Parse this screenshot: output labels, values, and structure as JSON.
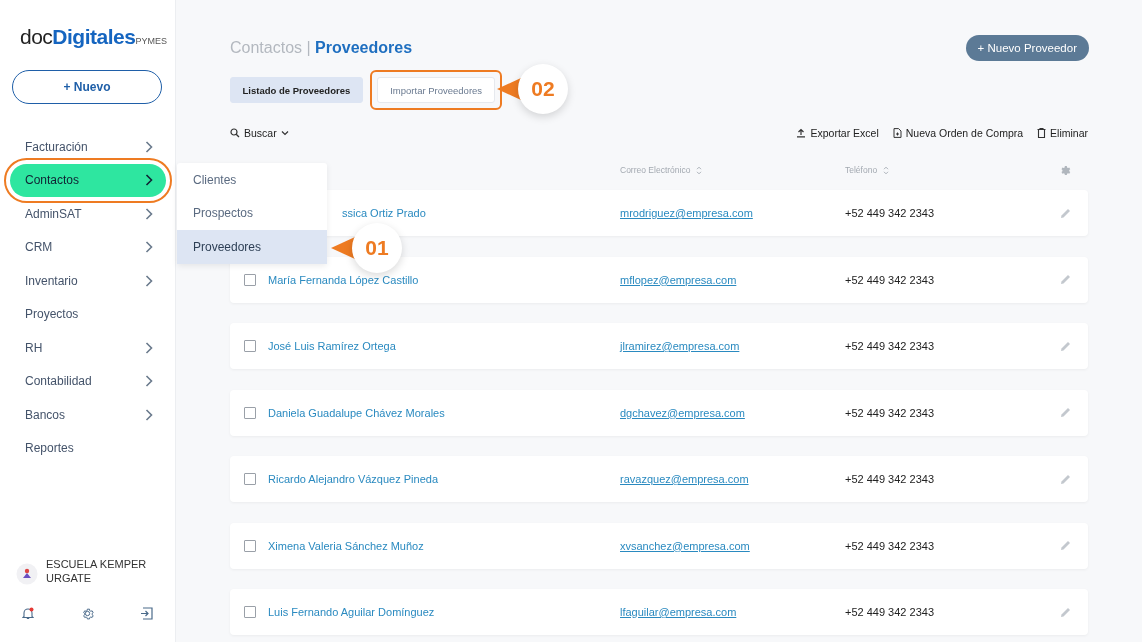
{
  "logo": {
    "prefix": "doc",
    "main": "Digitales",
    "suffix": "PYMES"
  },
  "new_button": {
    "icon": "+",
    "label": "Nuevo"
  },
  "sidebar": {
    "items": [
      {
        "label": "Facturación",
        "expandable": true,
        "selected": false,
        "highlighted": false
      },
      {
        "label": "Contactos",
        "expandable": true,
        "selected": true,
        "highlighted": true
      },
      {
        "label": "AdminSAT",
        "expandable": true,
        "selected": false,
        "highlighted": false
      },
      {
        "label": "CRM",
        "expandable": true,
        "selected": false,
        "highlighted": false
      },
      {
        "label": "Inventario",
        "expandable": true,
        "selected": false,
        "highlighted": false
      },
      {
        "label": "Proyectos",
        "expandable": false,
        "selected": false,
        "highlighted": false
      },
      {
        "label": "RH",
        "expandable": true,
        "selected": false,
        "highlighted": false
      },
      {
        "label": "Contabilidad",
        "expandable": true,
        "selected": false,
        "highlighted": false
      },
      {
        "label": "Bancos",
        "expandable": true,
        "selected": false,
        "highlighted": false
      },
      {
        "label": "Reportes",
        "expandable": false,
        "selected": false,
        "highlighted": false
      }
    ],
    "submenu": [
      {
        "label": "Clientes",
        "selected": false
      },
      {
        "label": "Prospectos",
        "selected": false
      },
      {
        "label": "Proveedores",
        "selected": true
      }
    ],
    "account": {
      "name": "ESCUELA KEMPER URGATE"
    },
    "notification_dot": true
  },
  "breadcrumb": {
    "parent": "Contactos",
    "separator": "|",
    "current": "Proveedores"
  },
  "primary_button": {
    "icon": "+",
    "label": "Nuevo Proveedor"
  },
  "tabs": [
    {
      "label": "Listado de Proveedores",
      "selected": true,
      "highlighted": false
    },
    {
      "label": "Importar Proveedores",
      "selected": false,
      "highlighted": true
    }
  ],
  "search": {
    "label": "Buscar"
  },
  "actions": [
    {
      "kind": "export",
      "label": "Exportar Excel"
    },
    {
      "kind": "order",
      "label": "Nueva Orden de Compra"
    },
    {
      "kind": "delete",
      "label": "Eliminar"
    }
  ],
  "table": {
    "columns": [
      {
        "label": "Correo Electrónico"
      },
      {
        "label": "Teléfono"
      }
    ],
    "rows": [
      {
        "name": "ssica Ortiz Prado",
        "email": "mrodriguez@empresa.com",
        "phone": "+52 449 342 2343"
      },
      {
        "name": "María Fernanda López Castillo",
        "email": "mflopez@empresa.com",
        "phone": "+52 449 342 2343",
        "checked": false
      },
      {
        "name": "José Luis Ramírez Ortega",
        "email": "jlramirez@empresa.com",
        "phone": "+52 449 342 2343",
        "checked": false
      },
      {
        "name": "Daniela Guadalupe Chávez Morales",
        "email": "dgchavez@empresa.com",
        "phone": "+52 449 342 2343",
        "checked": false
      },
      {
        "name": "Ricardo Alejandro Vázquez Pineda",
        "email": "ravazquez@empresa.com",
        "phone": "+52 449 342 2343",
        "checked": false
      },
      {
        "name": "Ximena Valeria Sánchez Muñoz",
        "email": "xvsanchez@empresa.com",
        "phone": "+52 449 342 2343",
        "checked": false
      },
      {
        "name": "Luis Fernando Aguilar Domínguez",
        "email": "lfaguilar@empresa.com",
        "phone": "+52 449 342 2343",
        "checked": false
      }
    ]
  },
  "callouts": [
    {
      "label": "01"
    },
    {
      "label": "02"
    }
  ]
}
